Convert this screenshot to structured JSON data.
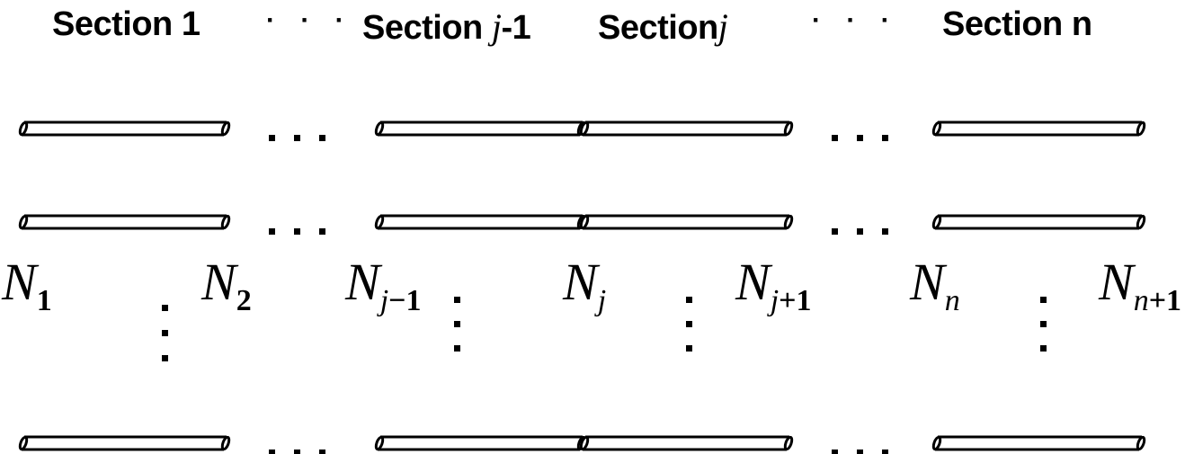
{
  "sections": [
    {
      "prefix": "Section",
      "index": "1",
      "var": ""
    },
    {
      "prefix": "Section",
      "index": "-1",
      "var": "j"
    },
    {
      "prefix": "Section",
      "index": "",
      "var": "j"
    },
    {
      "prefix": "Section",
      "index": "n",
      "var": ""
    }
  ],
  "ellipsis": "· · ·",
  "nodes": [
    {
      "symbol": "N",
      "sub_var": "",
      "sub_num": "1"
    },
    {
      "symbol": "N",
      "sub_var": "",
      "sub_num": "2"
    },
    {
      "symbol": "N",
      "sub_var": "j",
      "sub_num": "−1"
    },
    {
      "symbol": "N",
      "sub_var": "j",
      "sub_num": ""
    },
    {
      "symbol": "N",
      "sub_var": "j",
      "sub_num": "+1"
    },
    {
      "symbol": "N",
      "sub_var": "n",
      "sub_num": ""
    },
    {
      "symbol": "N",
      "sub_var": "n",
      "sub_num": "+1"
    }
  ],
  "colors": {
    "stroke": "#000000",
    "background": "#ffffff"
  }
}
